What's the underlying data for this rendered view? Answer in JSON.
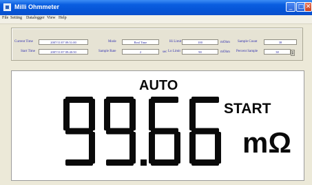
{
  "window": {
    "title": "Milli Ohmmeter",
    "controls": {
      "minimize": "_",
      "maximize": "□",
      "close": "✕"
    }
  },
  "menu": [
    "File",
    "Setting",
    "Datalogger",
    "View",
    "Help"
  ],
  "params": {
    "current_time": {
      "label": "Current Time",
      "value": "2007/11/07 09:51:00"
    },
    "start_time": {
      "label": "Start Time",
      "value": "2007/11/07 09:40:50"
    },
    "mode": {
      "label": "Mode",
      "value": "Real Time"
    },
    "sample_rate": {
      "label": "Sample Rate",
      "value": "2",
      "unit": "sec"
    },
    "hi_limit": {
      "label": "Hi Limit",
      "value": "100",
      "unit": "mOhm"
    },
    "lo_limit": {
      "label": "Lo Limit",
      "value": "90",
      "unit": "mOhm"
    },
    "sample_count": {
      "label": "Sample Count",
      "value": "38"
    },
    "percent_sample": {
      "label": "Percent Sample",
      "value": "38"
    }
  },
  "display": {
    "mode": "AUTO",
    "reading": "99.66",
    "status": "START",
    "unit": "mΩ",
    "color": "#0a0a0a"
  }
}
